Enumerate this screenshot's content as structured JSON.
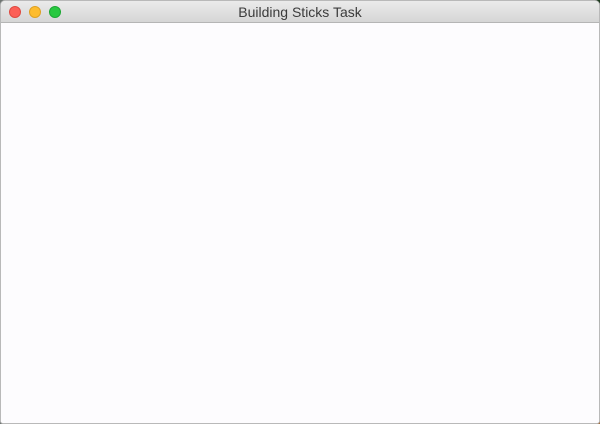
{
  "window": {
    "title": "Building Sticks Task",
    "controls": {
      "close_color": "#fc5f57",
      "minimize_color": "#fdbc2e",
      "zoom_color": "#28c840"
    }
  },
  "content": {
    "background": "#fdfcfe"
  }
}
